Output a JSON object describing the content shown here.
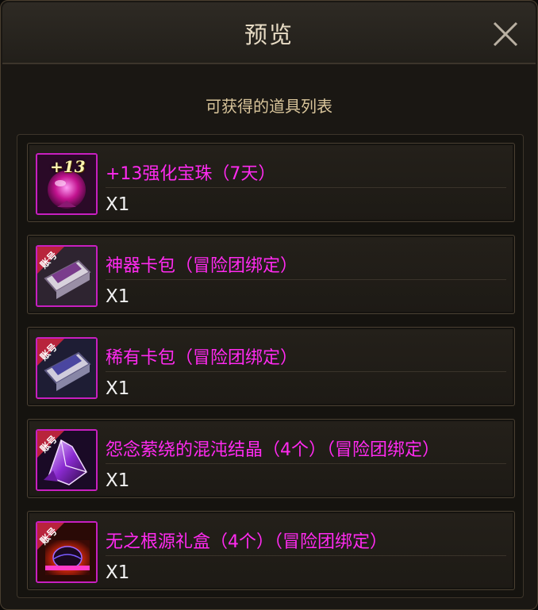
{
  "window": {
    "title": "预览"
  },
  "header": {
    "subtitle": "可获得的道具列表"
  },
  "items": [
    {
      "name": "+13强化宝珠（7天）",
      "quantity": "X1",
      "icon": "orb-icon",
      "badge": "+13"
    },
    {
      "name": "神器卡包（冒险团绑定）",
      "quantity": "X1",
      "icon": "card-pack-icon",
      "tag": "账号"
    },
    {
      "name": "稀有卡包（冒险团绑定）",
      "quantity": "X1",
      "icon": "card-pack-icon",
      "tag": "账号"
    },
    {
      "name": "怨念萦绕的混沌结晶（4个）（冒险团绑定）",
      "quantity": "X1",
      "icon": "crystal-icon",
      "tag": "账号"
    },
    {
      "name": "无之根源礼盒（4个）（冒险团绑定）",
      "quantity": "X1",
      "icon": "gift-box-icon",
      "tag": "账号"
    }
  ],
  "colors": {
    "item_name": "#ff2af0",
    "quantity": "#f2f2f2",
    "subtitle": "#d8c49a",
    "title": "#e8dcc5"
  }
}
